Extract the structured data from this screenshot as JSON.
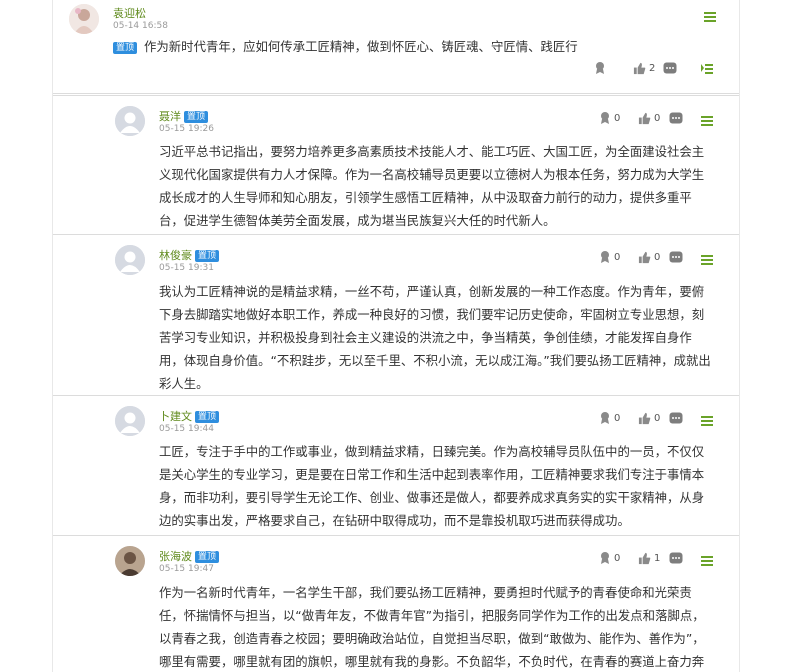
{
  "posts": [
    {
      "author": "袁迎松",
      "time": "05-14 16:58",
      "badge": "置顶",
      "content": "作为新时代青年，应如何传承工匠精神，做到怀匠心、铸匠魂、守匠情、践匠行",
      "award_count": "",
      "like_count": "2",
      "avatar_icon": "user-photo-avatar"
    },
    {
      "author": "聂洋",
      "time": "05-15 19:26",
      "badge": "置顶",
      "content": "习近平总书记指出，要努力培养更多高素质技术技能人才、能工巧匠、大国工匠，为全面建设社会主义现代化国家提供有力人才保障。作为一名高校辅导员更要以立德树人为根本任务，努力成为大学生成长成才的人生导师和知心朋友，引领学生感悟工匠精神，从中汲取奋力前行的动力，提供多重平台，促进学生德智体美劳全面发展，成为堪当民族复兴大任的时代新人。",
      "award_count": "0",
      "like_count": "0",
      "avatar_icon": "default-user-avatar"
    },
    {
      "author": "林俊豪",
      "time": "05-15 19:31",
      "badge": "置顶",
      "content": "我认为工匠精神说的是精益求精，一丝不苟，严谨认真，创新发展的一种工作态度。作为青年，要俯下身去脚踏实地做好本职工作，养成一种良好的习惯，我们要牢记历史使命，牢固树立专业思想，刻苦学习专业知识，并积极投身到社会主义建设的洪流之中，争当精英，争创佳绩，才能发挥自身作用，体现自身价值。“不积跬步，无以至千里、不积小流，无以成江海。”我们要弘扬工匠精神，成就出彩人生。",
      "award_count": "0",
      "like_count": "0",
      "avatar_icon": "default-user-avatar"
    },
    {
      "author": "卜建文",
      "time": "05-15 19:44",
      "badge": "置顶",
      "content": "工匠，专注于手中的工作或事业，做到精益求精，日臻完美。作为高校辅导员队伍中的一员，不仅仅是关心学生的专业学习，更是要在日常工作和生活中起到表率作用，工匠精神要求我们专注于事情本身，而非功利，要引导学生无论工作、创业、做事还是做人，都要养成求真务实的实干家精神，从身边的实事出发，严格要求自己，在钻研中取得成功，而不是靠投机取巧进而获得成功。",
      "award_count": "0",
      "like_count": "0",
      "avatar_icon": "default-user-avatar"
    },
    {
      "author": "张海波",
      "time": "05-15 19:47",
      "badge": "置顶",
      "content": "作为一名新时代青年，一名学生干部，我们要弘扬工匠精神，要勇担时代赋予的青春使命和光荣责任，怀揣情怀与担当，以“做青年友，不做青年官”为指引，把服务同学作为工作的出发点和落脚点，以青春之我，创造青春之校园；要明确政治站位，自觉担当尽职，做到“敢做为、能作为、善作为”，哪里有需要，哪里就有团的旗帜，哪里就有我的身影。不负韶华，不负时代，在青春的赛道上奋力奔跑，争取跑出当代青年的最好成绩！",
      "award_count": "0",
      "like_count": "1",
      "avatar_icon": "user-photo-avatar"
    }
  ],
  "colors": {
    "author": "#5f8a1c",
    "badge": "#2e8ede",
    "menu_icon": "#6aa329",
    "divider": "#dcdcdc"
  }
}
